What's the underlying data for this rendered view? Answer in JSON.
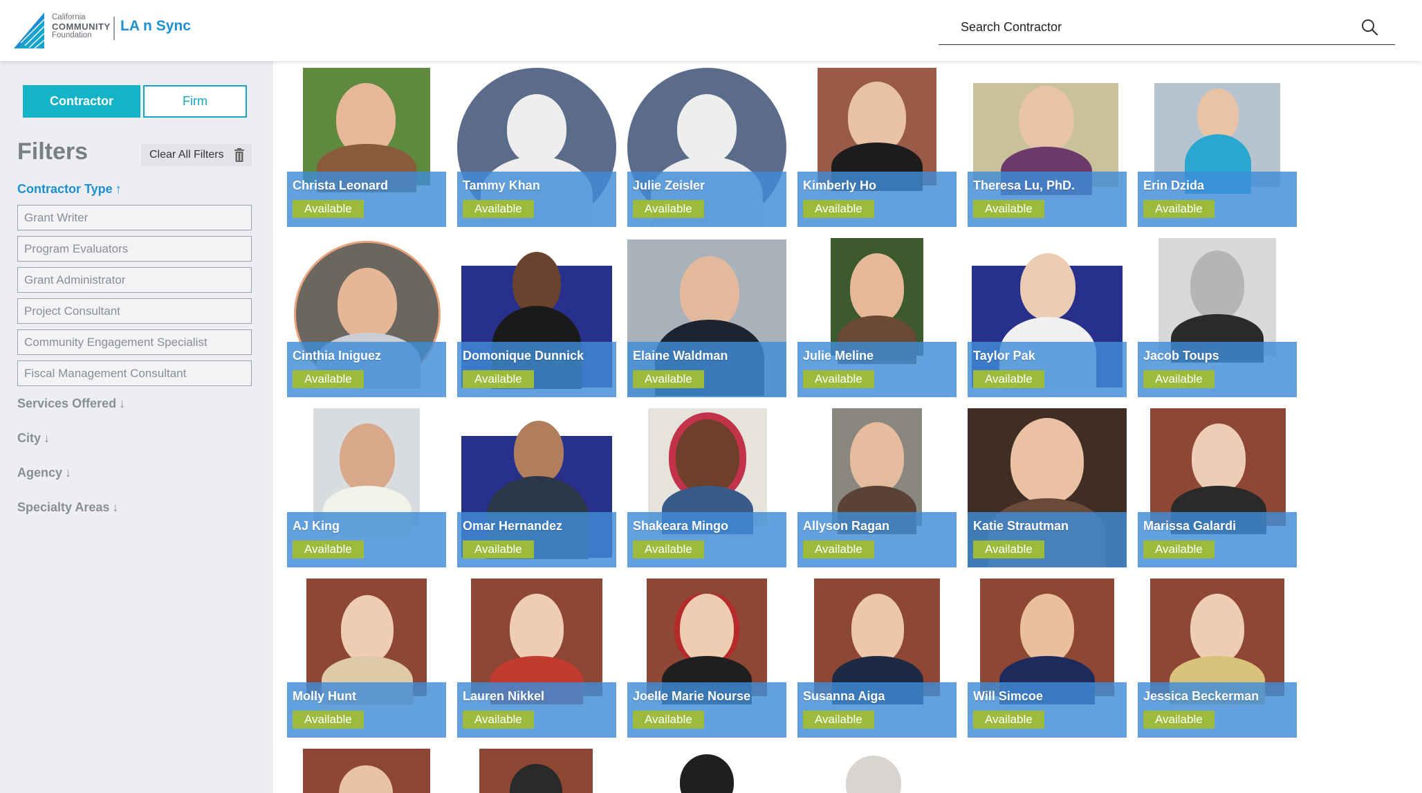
{
  "header": {
    "logo_line1": "California",
    "logo_line2": "COMMUNITY",
    "logo_line3": "Foundation",
    "app_name": "LA n Sync",
    "search_placeholder": "Search Contractor"
  },
  "sidebar": {
    "tabs": [
      {
        "label": "Contractor",
        "active": true
      },
      {
        "label": "Firm",
        "active": false
      }
    ],
    "filters_title": "Filters",
    "clear_label": "Clear All Filters",
    "contractor_type": {
      "label": "Contractor Type",
      "arrow": "↑",
      "options": [
        "Grant Writer",
        "Program Evaluators",
        "Grant Administrator",
        "Project Consultant",
        "Community Engagement Specialist",
        "Fiscal Management Consultant"
      ]
    },
    "collapsed_filters": [
      {
        "label": "Services Offered",
        "arrow": "↓"
      },
      {
        "label": "City",
        "arrow": "↓"
      },
      {
        "label": "Agency",
        "arrow": "↓"
      },
      {
        "label": "Specialty Areas",
        "arrow": "↓"
      }
    ]
  },
  "contractors": [
    {
      "name": "Christa Leonard",
      "status": "Available"
    },
    {
      "name": "Tammy Khan",
      "status": "Available"
    },
    {
      "name": "Julie Zeisler",
      "status": "Available"
    },
    {
      "name": "Kimberly Ho",
      "status": "Available"
    },
    {
      "name": "Theresa Lu, PhD.",
      "status": "Available"
    },
    {
      "name": "Erin Dzida",
      "status": "Available"
    },
    {
      "name": "Cinthia Iniguez",
      "status": "Available"
    },
    {
      "name": "Domonique Dunnick",
      "status": "Available"
    },
    {
      "name": "Elaine Waldman",
      "status": "Available"
    },
    {
      "name": "Julie Meline",
      "status": "Available"
    },
    {
      "name": "Taylor Pak",
      "status": "Available"
    },
    {
      "name": "Jacob Toups",
      "status": "Available"
    },
    {
      "name": "AJ King",
      "status": "Available"
    },
    {
      "name": "Omar Hernandez",
      "status": "Available"
    },
    {
      "name": "Shakeara Mingo",
      "status": "Available"
    },
    {
      "name": "Allyson Ragan",
      "status": "Available"
    },
    {
      "name": "Katie Strautman",
      "status": "Available"
    },
    {
      "name": "Marissa Galardi",
      "status": "Available"
    },
    {
      "name": "Molly Hunt",
      "status": "Available"
    },
    {
      "name": "Lauren Nikkel",
      "status": "Available"
    },
    {
      "name": "Joelle Marie Nourse",
      "status": "Available"
    },
    {
      "name": "Susanna Aiga",
      "status": "Available"
    },
    {
      "name": "Will Simcoe",
      "status": "Available"
    },
    {
      "name": "Jessica Beckerman",
      "status": "Available"
    }
  ],
  "colors": {
    "accent": "#14b3c8",
    "brand_blue": "#1b8fd0",
    "card_overlay": "#408cd7",
    "available_badge": "#9dbb3a"
  }
}
